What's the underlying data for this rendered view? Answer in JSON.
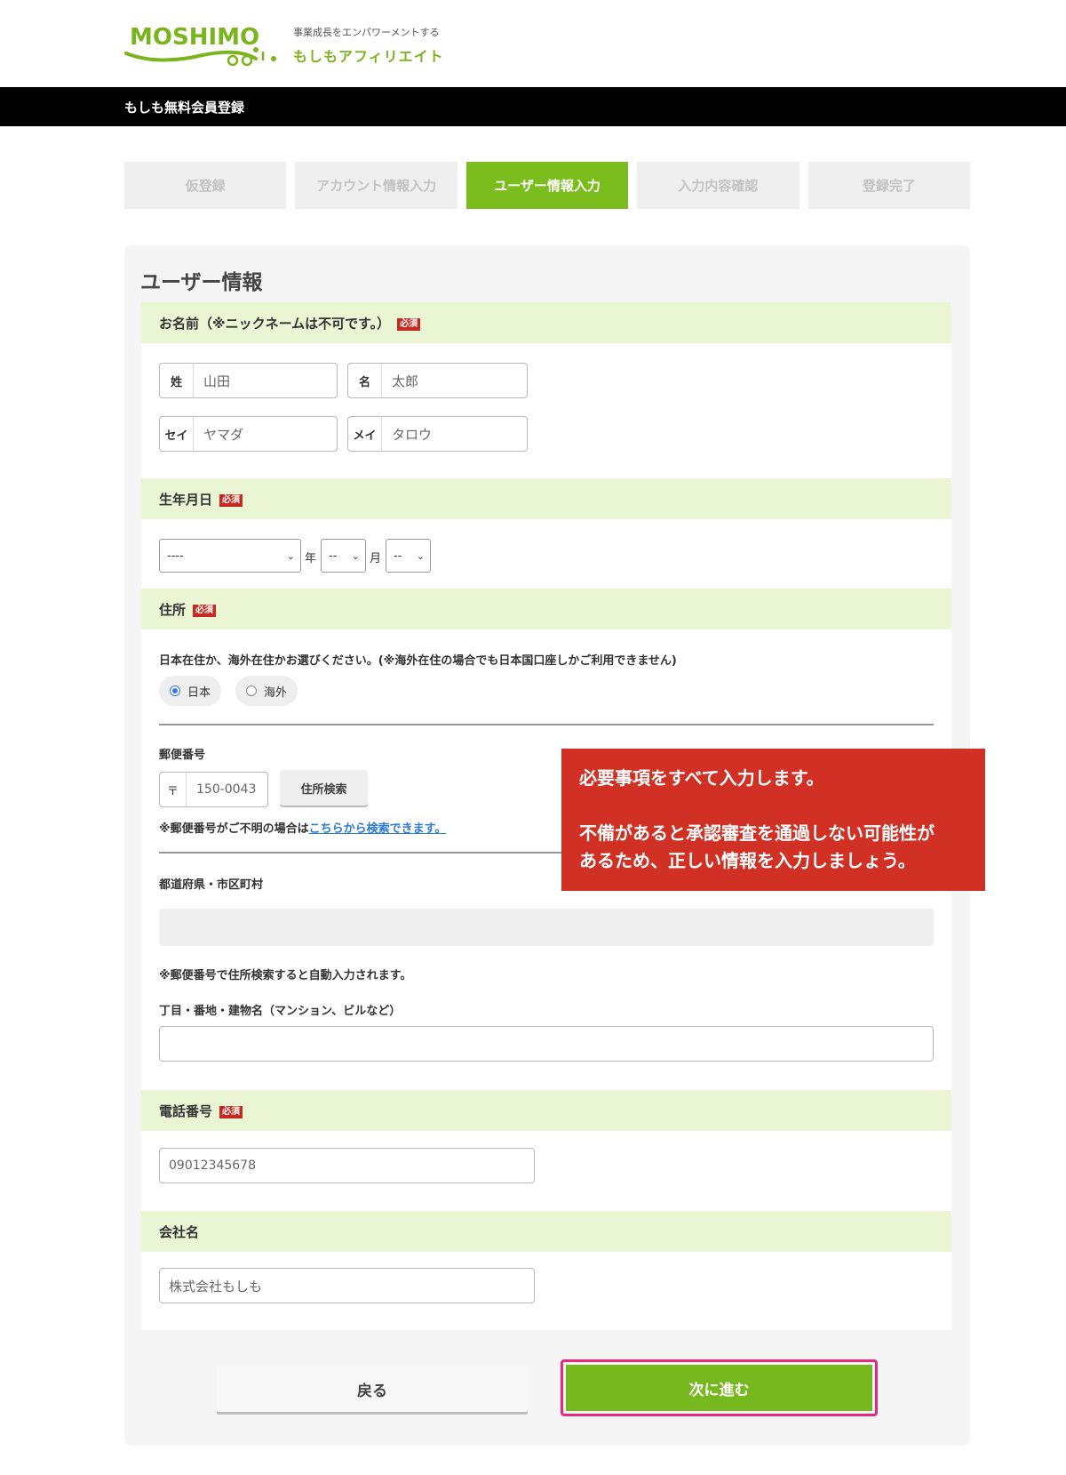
{
  "header": {
    "logo_text": "MOSHIMO",
    "tagline": "事業成長をエンパワーメントする",
    "brand": "もしもアフィリエイト",
    "bar_title": "もしも無料会員登録"
  },
  "steps": [
    {
      "label": "仮登録",
      "active": false
    },
    {
      "label": "アカウント情報入力",
      "active": false
    },
    {
      "label": "ユーザー情報入力",
      "active": true
    },
    {
      "label": "入力内容確認",
      "active": false
    },
    {
      "label": "登録完了",
      "active": false
    }
  ],
  "form": {
    "title": "ユーザー情報",
    "required_badge": "必須",
    "name_section": {
      "heading": "お名前（※ニックネームは不可です。）",
      "last_name_label": "姓",
      "last_name_placeholder": "山田",
      "first_name_label": "名",
      "first_name_placeholder": "太郎",
      "last_kana_label": "セイ",
      "last_kana_placeholder": "ヤマダ",
      "first_kana_label": "メイ",
      "first_kana_placeholder": "タロウ"
    },
    "birth_section": {
      "heading": "生年月日",
      "year_value": "----",
      "year_unit": "年",
      "month_value": "--",
      "month_unit": "月",
      "day_value": "--"
    },
    "address_section": {
      "heading": "住所",
      "residence_note": "日本在住か、海外在住かお選びください。(※海外在住の場合でも日本国口座しかご利用できません)",
      "radio_japan": "日本",
      "radio_overseas": "海外",
      "selected": "日本",
      "postal_label": "郵便番号",
      "postal_prefix": "〒",
      "postal_placeholder": "150-0043",
      "search_button": "住所検索",
      "postal_help_prefix": "※郵便番号がご不明の場合は",
      "postal_help_link": "こちらから検索できます。",
      "prefecture_label": "都道府県・市区町村",
      "autofill_note": "※郵便番号で住所検索すると自動入力されます。",
      "street_label": "丁目・番地・建物名（マンション、ビルなど）",
      "street_value": ""
    },
    "phone_section": {
      "heading": "電話番号",
      "placeholder": "09012345678"
    },
    "company_section": {
      "heading": "会社名",
      "placeholder": "株式会社もしも"
    }
  },
  "buttons": {
    "back": "戻る",
    "next": "次に進む"
  },
  "callout": {
    "line1": "必要事項をすべて入力します。",
    "line2": "不備があると承認審査を通過しない可能性が",
    "line3": "あるため、正しい情報を入力しましょう。"
  },
  "colors": {
    "accent_green": "#7cbd1e",
    "section_bg": "#eaf5d3",
    "required_red": "#c7281f",
    "callout_red": "#d03124",
    "highlight_pink": "#e6297a"
  }
}
